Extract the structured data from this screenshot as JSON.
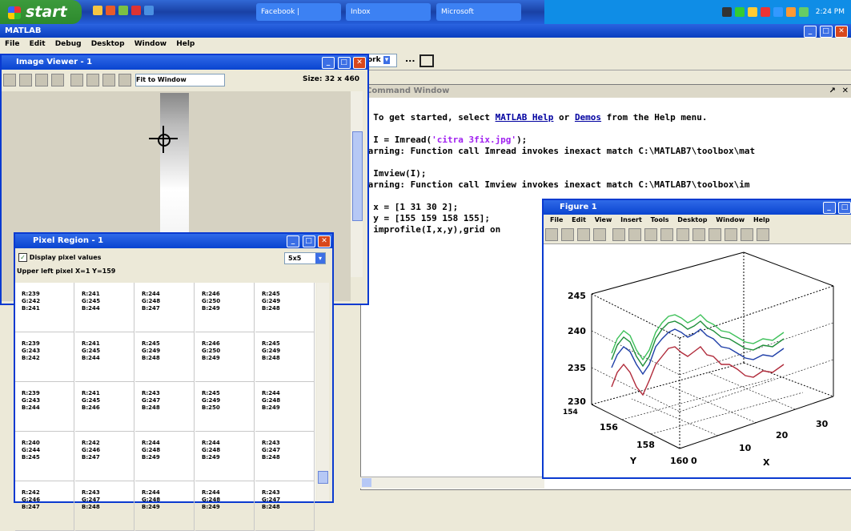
{
  "taskbar": {
    "start_label": "start",
    "buttons": [
      "Facebook |",
      "Inbox",
      "Microsoft",
      ""
    ],
    "clock": "2:24 PM"
  },
  "matlab": {
    "title": "MATLAB",
    "menu": [
      "File",
      "Edit",
      "Debug",
      "Desktop",
      "Window",
      "Help"
    ],
    "current_dir_fragment": "ork"
  },
  "image_viewer": {
    "title": "Image Viewer - 1",
    "magnification": "Fit to Window",
    "size_label": "Size: 32 x 460"
  },
  "pixel_region": {
    "title": "Pixel Region - 1",
    "display_checkbox_label": "Display pixel values",
    "grid_select": "5x5",
    "upper_left_label": "Upper left pixel X=1 Y=159",
    "rows": [
      [
        [
          "R:239",
          "G:242",
          "B:241"
        ],
        [
          "R:241",
          "G:245",
          "B:244"
        ],
        [
          "R:244",
          "G:248",
          "B:247"
        ],
        [
          "R:246",
          "G:250",
          "B:249"
        ],
        [
          "R:245",
          "G:249",
          "B:248"
        ]
      ],
      [
        [
          "R:239",
          "G:243",
          "B:242"
        ],
        [
          "R:241",
          "G:245",
          "B:244"
        ],
        [
          "R:245",
          "G:249",
          "B:248"
        ],
        [
          "R:246",
          "G:250",
          "B:249"
        ],
        [
          "R:245",
          "G:249",
          "B:248"
        ]
      ],
      [
        [
          "R:239",
          "G:243",
          "B:244"
        ],
        [
          "R:241",
          "G:245",
          "B:246"
        ],
        [
          "R:243",
          "G:247",
          "B:248"
        ],
        [
          "R:245",
          "G:249",
          "B:250"
        ],
        [
          "R:244",
          "G:248",
          "B:249"
        ]
      ],
      [
        [
          "R:240",
          "G:244",
          "B:245"
        ],
        [
          "R:242",
          "G:246",
          "B:247"
        ],
        [
          "R:244",
          "G:248",
          "B:249"
        ],
        [
          "R:244",
          "G:248",
          "B:249"
        ],
        [
          "R:243",
          "G:247",
          "B:248"
        ]
      ],
      [
        [
          "R:242",
          "G:246",
          "B:247"
        ],
        [
          "R:243",
          "G:247",
          "B:248"
        ],
        [
          "R:244",
          "G:248",
          "B:249"
        ],
        [
          "R:244",
          "G:248",
          "B:249"
        ],
        [
          "R:243",
          "G:247",
          "B:248"
        ]
      ]
    ]
  },
  "command_window": {
    "title": "Command Window",
    "intro_pre": "  To get started, select ",
    "intro_link1": "MATLAB Help",
    "intro_mid": " or ",
    "intro_link2": "Demos",
    "intro_post": " from the Help menu.",
    "line1_pre": "> I = Imread(",
    "line1_str": "'citra 3fix.jpg'",
    "line1_post": ");",
    "warn1": "Warning: Function call Imread invokes inexact match C:\\MATLAB7\\toolbox\\mat",
    "line2": "> Imview(I);",
    "warn2": "Warning: Function call Imview invokes inexact match C:\\MATLAB7\\toolbox\\im",
    "line3": "> x = [1 31 30 2];",
    "line4": "> y = [155 159 158 155];",
    "line5": "> improfile(I,x,y),grid on",
    "line6": ">"
  },
  "figure": {
    "title": "Figure 1",
    "menu": [
      "File",
      "Edit",
      "View",
      "Insert",
      "Tools",
      "Desktop",
      "Window",
      "Help"
    ],
    "z_ticks": [
      "245",
      "240",
      "235",
      "230"
    ],
    "y_ticks": [
      "154",
      "156",
      "158",
      "160"
    ],
    "x_ticks": [
      "0",
      "10",
      "20",
      "30"
    ],
    "y_label": "Y",
    "x_label": "X",
    "series_colors": [
      "#1f8f3a",
      "#3ec15a",
      "#1f3fa8",
      "#b02a3a"
    ]
  }
}
